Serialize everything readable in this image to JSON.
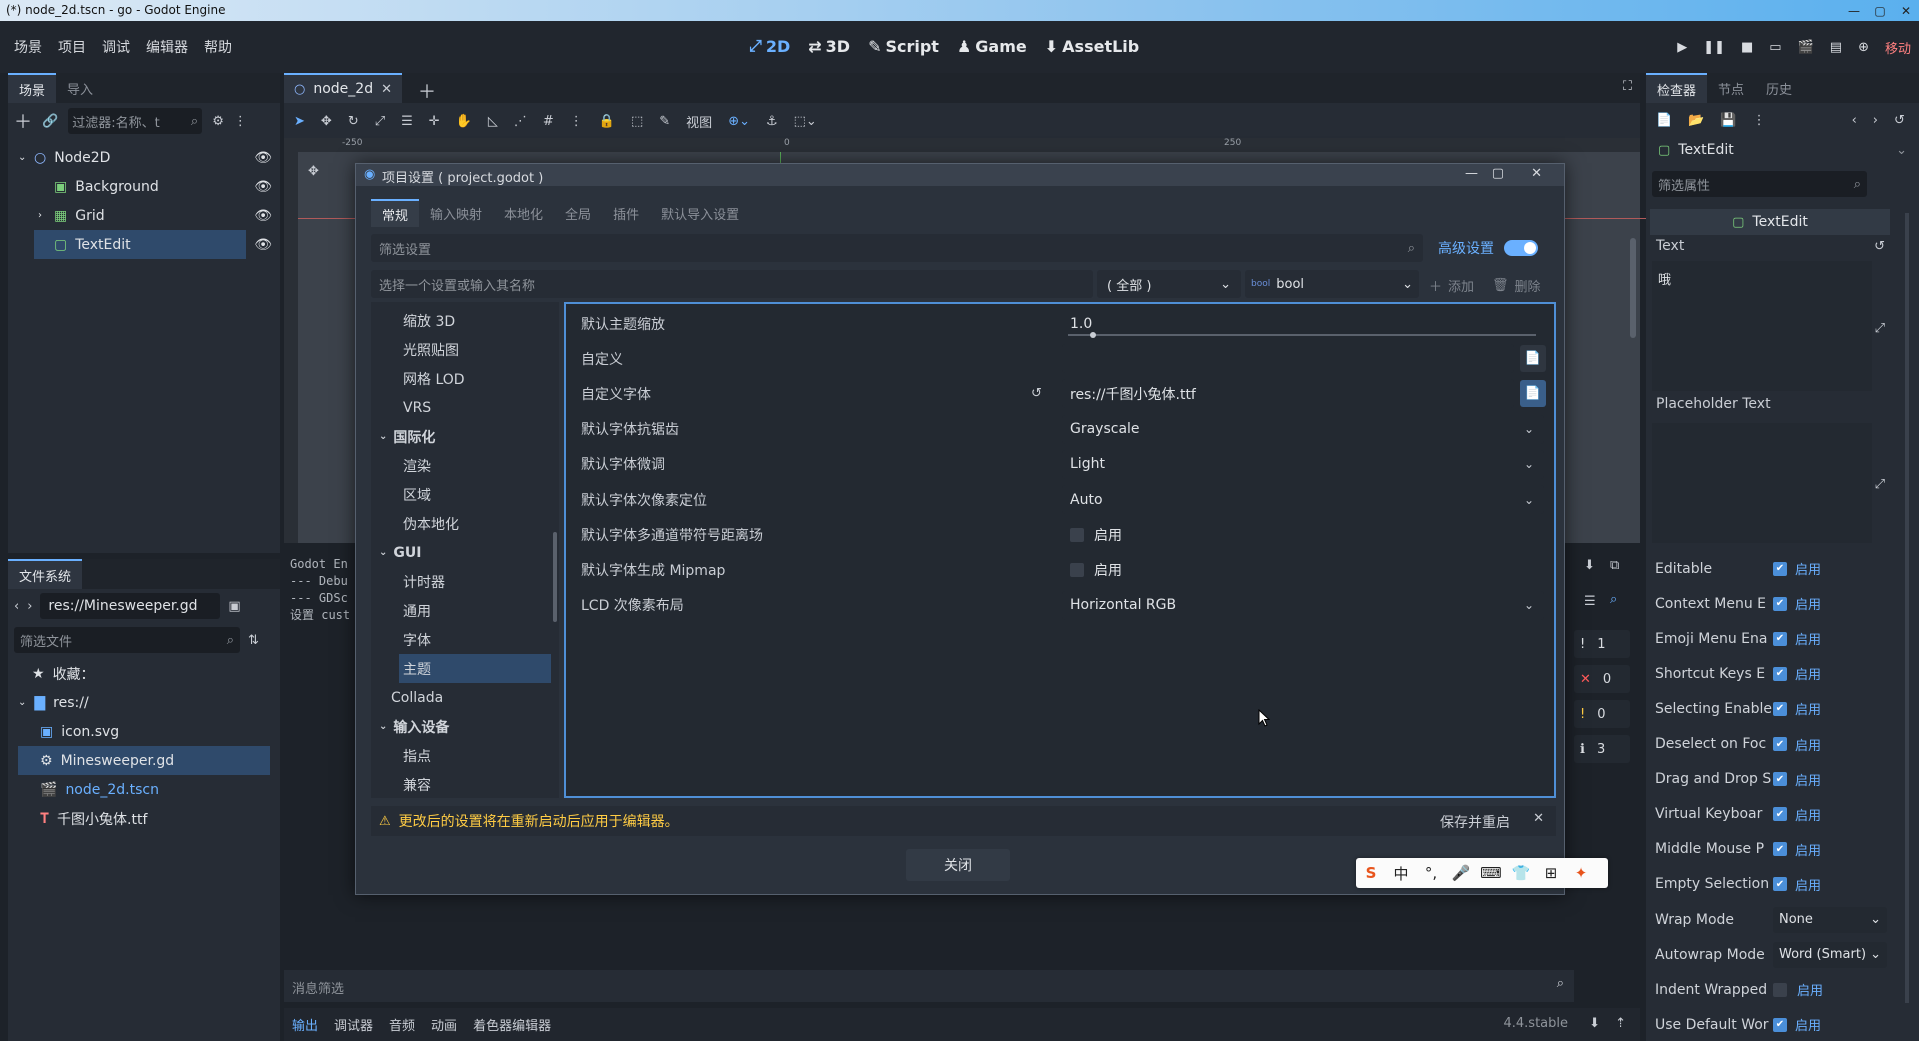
{
  "window": {
    "title": "(*) node_2d.tscn - go - Godot Engine"
  },
  "menu": [
    "场景",
    "项目",
    "调试",
    "编辑器",
    "帮助"
  ],
  "workspaces": [
    "2D",
    "3D",
    "Script",
    "Game",
    "AssetLib"
  ],
  "renderer": "移动",
  "scene_dock": {
    "tabs": [
      "场景",
      "导入"
    ],
    "filter_placeholder": "过滤器:名称、t",
    "nodes": [
      "Node2D",
      "Background",
      "Grid",
      "TextEdit"
    ]
  },
  "filesystem": {
    "tab": "文件系统",
    "path": "res://Minesweeper.gd",
    "filter_placeholder": "筛选文件",
    "favorites": "收藏：",
    "root": "res://",
    "files": [
      "icon.svg",
      "Minesweeper.gd",
      "node_2d.tscn",
      "千图小兔体.ttf"
    ]
  },
  "editor_tab": "node_2d",
  "toolbar": {
    "view": "视图"
  },
  "ruler": [
    "-250",
    "0",
    "250"
  ],
  "output": {
    "lines": [
      "Godot En",
      "--- Debu",
      "--- GDSc",
      "设置 cust"
    ],
    "filter_placeholder": "消息筛选",
    "badges": [
      "1",
      "0",
      "0",
      "3"
    ]
  },
  "bottom_tabs": [
    "输出",
    "调试器",
    "音频",
    "动画",
    "着色器编辑器"
  ],
  "version": "4.4.stable",
  "dialog": {
    "title": "项目设置 ( project.godot )",
    "tabs": [
      "常规",
      "输入映射",
      "本地化",
      "全局",
      "插件",
      "默认导入设置"
    ],
    "filter_placeholder": "筛选设置",
    "advanced": "高级设置",
    "setting_placeholder": "选择一个设置或输入其名称",
    "type_all": "( 全部 )",
    "type_value": "bool",
    "add": "添加",
    "delete": "删除",
    "categories": [
      {
        "label": "缩放 3D",
        "indent": 1
      },
      {
        "label": "光照贴图",
        "indent": 1
      },
      {
        "label": "网格 LOD",
        "indent": 1
      },
      {
        "label": "VRS",
        "indent": 1
      },
      {
        "label": "国际化",
        "indent": 0,
        "group": true
      },
      {
        "label": "渲染",
        "indent": 1
      },
      {
        "label": "区域",
        "indent": 1
      },
      {
        "label": "伪本地化",
        "indent": 1
      },
      {
        "label": "GUI",
        "indent": 0,
        "group": true
      },
      {
        "label": "计时器",
        "indent": 1
      },
      {
        "label": "通用",
        "indent": 1
      },
      {
        "label": "字体",
        "indent": 1
      },
      {
        "label": "主题",
        "indent": 1,
        "selected": true
      },
      {
        "label": "Collada",
        "indent": 0
      },
      {
        "label": "输入设备",
        "indent": 0,
        "group": true
      },
      {
        "label": "指点",
        "indent": 1
      },
      {
        "label": "兼容",
        "indent": 1
      }
    ],
    "props": [
      {
        "label": "默认主题缩放",
        "kind": "slider",
        "value": "1.0"
      },
      {
        "label": "自定义",
        "kind": "file",
        "value": ""
      },
      {
        "label": "自定义字体",
        "kind": "file",
        "value": "res://千图小兔体.ttf",
        "revert": true
      },
      {
        "label": "默认字体抗锯齿",
        "kind": "enum",
        "value": "Grayscale"
      },
      {
        "label": "默认字体微调",
        "kind": "enum",
        "value": "Light"
      },
      {
        "label": "默认字体次像素定位",
        "kind": "enum",
        "value": "Auto"
      },
      {
        "label": "默认字体多通道带符号距离场",
        "kind": "check",
        "value": "启用"
      },
      {
        "label": "默认字体生成 Mipmap",
        "kind": "check",
        "value": "启用"
      },
      {
        "label": "LCD 次像素布局",
        "kind": "enum",
        "value": "Horizontal RGB"
      }
    ],
    "warning": "更改后的设置将在重新启动后应用于编辑器。",
    "save_restart": "保存并重启",
    "close": "关闭"
  },
  "inspector": {
    "tabs": [
      "检查器",
      "节点",
      "历史"
    ],
    "object": "TextEdit",
    "filter_placeholder": "筛选属性",
    "section": "TextEdit",
    "text_label": "Text",
    "text_value": "哦",
    "placeholder_label": "Placeholder Text",
    "props": [
      {
        "name": "Editable",
        "value": "启用",
        "on": true
      },
      {
        "name": "Context Menu E",
        "value": "启用",
        "on": true
      },
      {
        "name": "Emoji Menu Ena",
        "value": "启用",
        "on": true
      },
      {
        "name": "Shortcut Keys E",
        "value": "启用",
        "on": true
      },
      {
        "name": "Selecting Enable",
        "value": "启用",
        "on": true
      },
      {
        "name": "Deselect on Foc",
        "value": "启用",
        "on": true
      },
      {
        "name": "Drag and Drop S",
        "value": "启用",
        "on": true
      },
      {
        "name": "Virtual Keyboar",
        "value": "启用",
        "on": true
      },
      {
        "name": "Middle Mouse P",
        "value": "启用",
        "on": true
      },
      {
        "name": "Empty Selection",
        "value": "启用",
        "on": true
      },
      {
        "name": "Wrap Mode",
        "value": "None",
        "kind": "enum"
      },
      {
        "name": "Autowrap Mode",
        "value": "Word (Smart)",
        "kind": "enum"
      },
      {
        "name": "Indent Wrapped",
        "value": "启用",
        "on": false
      },
      {
        "name": "Use Default Wor",
        "value": "启用",
        "on": true
      }
    ]
  },
  "ime": [
    "S",
    "中",
    "°,",
    "🎤",
    "⌨",
    "👕",
    "⊞",
    "✦"
  ],
  "colors": {
    "accent": "#6ab0ff",
    "warning": "#ffcc44",
    "error": "#ff5a5a"
  }
}
